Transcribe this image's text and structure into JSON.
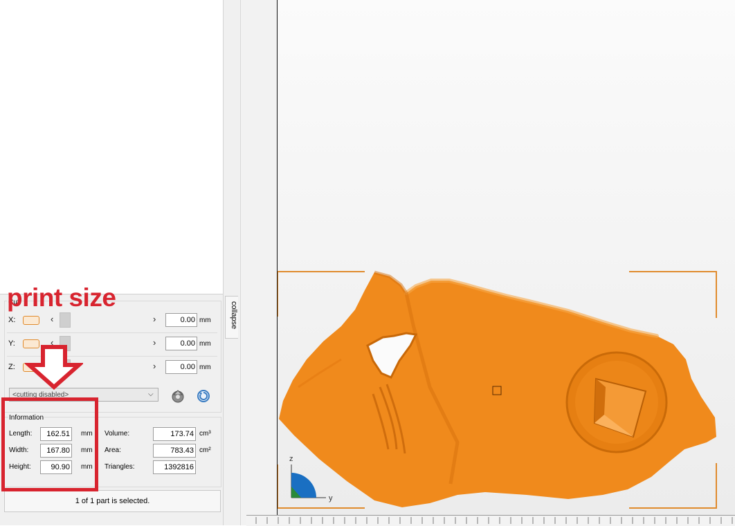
{
  "annotation": {
    "text": "print size",
    "color": "#d8242f"
  },
  "side_tab": {
    "label": "collapse"
  },
  "cut": {
    "group_label": "Cut",
    "axes": [
      {
        "axis": "X:",
        "value": "0.00",
        "unit": "mm"
      },
      {
        "axis": "Y:",
        "value": "0.00",
        "unit": "mm"
      },
      {
        "axis": "Z:",
        "value": "0.00",
        "unit": "mm"
      }
    ],
    "mode": "<cutting disabled>"
  },
  "information": {
    "title": "Information",
    "length": {
      "label": "Length:",
      "value": "162.51",
      "unit": "mm"
    },
    "width": {
      "label": "Width:",
      "value": "167.80",
      "unit": "mm"
    },
    "height": {
      "label": "Height:",
      "value": "90.90",
      "unit": "mm"
    },
    "volume": {
      "label": "Volume:",
      "value": "173.74",
      "unit": "cm³"
    },
    "area": {
      "label": "Area:",
      "value": "783.43",
      "unit": "cm²"
    },
    "triangles": {
      "label": "Triangles:",
      "value": "1392816"
    }
  },
  "status": {
    "text": "1 of 1 part is selected."
  },
  "axis_indicator": {
    "z": "z",
    "y": "y"
  },
  "colors": {
    "model": "#f08a1c",
    "selection": "#e08a2c",
    "annotation": "#d8242f"
  }
}
